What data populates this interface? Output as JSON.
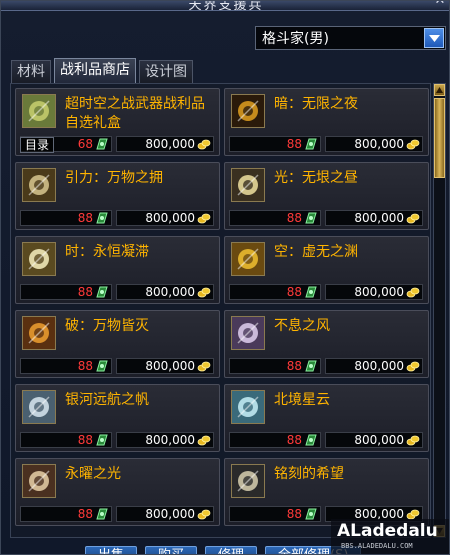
{
  "window": {
    "title": "天界支援兵",
    "close": "✕"
  },
  "job_select": {
    "value": "格斗家(男)"
  },
  "tabs": [
    {
      "label": "材料",
      "active": false
    },
    {
      "label": "战利品商店",
      "active": true
    },
    {
      "label": "设计图",
      "active": false
    }
  ],
  "items": [
    {
      "name": "超时空之战武器战利品自选礼盒",
      "points": "68",
      "gold": "800,000",
      "tag": "目录",
      "icon": "weapon-box-icon"
    },
    {
      "name": "暗：无限之夜",
      "points": "88",
      "gold": "800,000",
      "tag": "",
      "icon": "dark-orb-icon"
    },
    {
      "name": "引力：万物之拥",
      "points": "88",
      "gold": "800,000",
      "tag": "",
      "icon": "gravity-icon"
    },
    {
      "name": "光：无垠之昼",
      "points": "88",
      "gold": "800,000",
      "tag": "",
      "icon": "light-icon"
    },
    {
      "name": "时：永恒凝滞",
      "points": "88",
      "gold": "800,000",
      "tag": "",
      "icon": "time-icon"
    },
    {
      "name": "空：虚无之渊",
      "points": "88",
      "gold": "800,000",
      "tag": "",
      "icon": "void-icon"
    },
    {
      "name": "破：万物皆灭",
      "points": "88",
      "gold": "800,000",
      "tag": "",
      "icon": "destroy-icon"
    },
    {
      "name": "不息之风",
      "points": "88",
      "gold": "800,000",
      "tag": "",
      "icon": "wind-icon"
    },
    {
      "name": "银河远航之帆",
      "points": "88",
      "gold": "800,000",
      "tag": "",
      "icon": "galaxy-sail-icon"
    },
    {
      "name": "北境星云",
      "points": "88",
      "gold": "800,000",
      "tag": "",
      "icon": "nebula-icon"
    },
    {
      "name": "永曜之光",
      "points": "88",
      "gold": "800,000",
      "tag": "",
      "icon": "eternal-light-icon"
    },
    {
      "name": "铭刻的希望",
      "points": "88",
      "gold": "800,000",
      "tag": "",
      "icon": "hope-icon"
    }
  ],
  "bottom_buttons": [
    {
      "label": "出售"
    },
    {
      "label": "购买"
    },
    {
      "label": "修理"
    },
    {
      "label": "全部修理(S)"
    }
  ],
  "watermark": {
    "brand": "ALadedalu",
    "sub": "BBS.ALADEDALU.COM"
  },
  "colors": {
    "item_name": "#ffb400",
    "points": "#ff3a3a",
    "accent_blue": "#2c68b8",
    "gold": "#e0c070"
  }
}
